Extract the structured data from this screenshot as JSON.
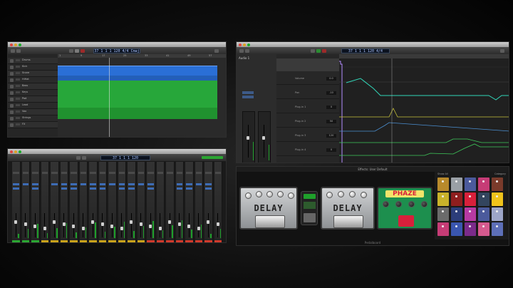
{
  "tracks_window": {
    "lcd": "37 1 1 1  120  4/4  Cmaj",
    "ruler_marks": [
      "1",
      "9",
      "17",
      "25",
      "33",
      "41",
      "49",
      "57"
    ],
    "track_names": [
      "Drums",
      "Kick",
      "Snare",
      "HiHat",
      "Bass",
      "Keys",
      "Pad",
      "Lead",
      "Vox",
      "Strings",
      "FX"
    ]
  },
  "automation_window": {
    "lcd": "37 1 1 1  120  4/4",
    "inspector_title": "Audio 1",
    "lane_labels": [
      "Volume",
      "Pan",
      "Plug-in 1",
      "Plug-in 2",
      "Plug-in 3",
      "Plug-in 4"
    ],
    "param_values": [
      "0.0",
      "-10",
      "0",
      "50",
      "120",
      "0"
    ]
  },
  "mixer_window": {
    "lcd": "37 1 1 1  120",
    "channel_count": 22
  },
  "pedalboard_window": {
    "title": "Effects: User Default",
    "footer": "Pedalboard",
    "pedals": [
      {
        "label": "DELAY",
        "color": "#b9bcbe"
      },
      {
        "label": "DELAY",
        "color": "#b9bcbe"
      },
      {
        "label": "PHAZE",
        "color": "#1d8f4e"
      }
    ],
    "browser_header": [
      "Show All",
      "Category"
    ],
    "colors": {
      "accent_green": "#1fa02b",
      "region_blue": "#2a6fd6",
      "region_green": "#27a73a",
      "phaze_red": "#d8203b"
    }
  }
}
